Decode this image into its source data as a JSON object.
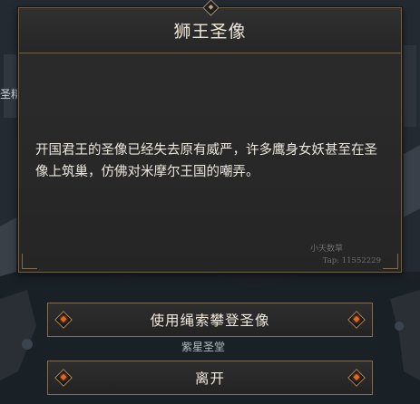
{
  "dialog": {
    "title": "狮王圣像",
    "message": "开国君王的圣像已经失去原有威严，许多鹰身女妖甚至在圣像上筑巢，仿佛对米摩尔王国的嘲弄。",
    "watermark_name": "小天数草",
    "watermark_tap": "Tap: 11552229"
  },
  "background": {
    "side_label": "圣精",
    "under_label": "紫星圣堂"
  },
  "actions": {
    "primary_label": "使用绳索攀登圣像",
    "leave_label": "离开"
  },
  "colors": {
    "panel": "#282828",
    "border": "#6e624f",
    "accent": "#e0642c"
  }
}
